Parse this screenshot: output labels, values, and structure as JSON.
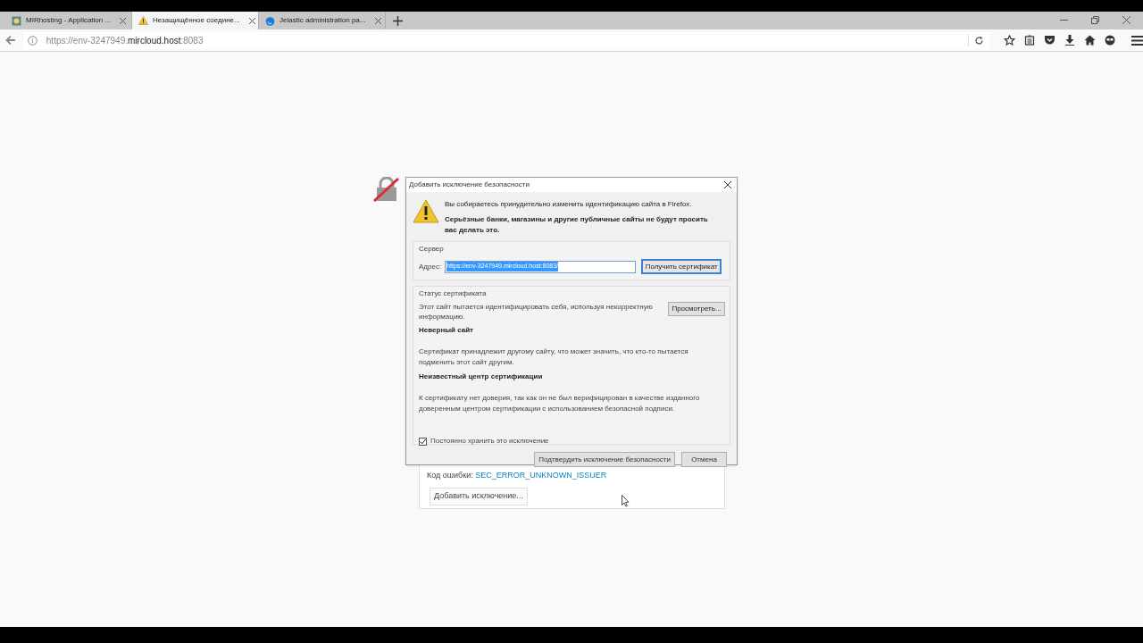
{
  "tabs": [
    {
      "title": "MIRhosting - Application ...",
      "selected": false
    },
    {
      "title": "Незащищённое соедине...",
      "selected": true
    },
    {
      "title": "Jelastic administration pa...",
      "selected": false
    }
  ],
  "url": {
    "prefix": "https://env-3247949.",
    "domain": "mircloud.host",
    "port": ":8083"
  },
  "dialog": {
    "title": "Добавить исключение безопасности",
    "warning_text": "Вы собираетесь принудительно изменить идентификацию сайта в Firefox.",
    "warning_bold": "Серьёзные банки, магазины и другие публичные сайты не будут просить вас делать это.",
    "server": {
      "legend": "Сервер",
      "address_label": "Адрес:",
      "address_value": "https://env-3247949.mircloud.host:8083/",
      "get_button": "Получить сертификат"
    },
    "status": {
      "legend": "Статус сертификата",
      "description": "Этот сайт пытается идентифицировать себя, используя некорректную информацию.",
      "view_button": "Просмотреть...",
      "problems": [
        {
          "title": "Неверный сайт",
          "text": "Сертификат принадлежит другому сайту, что может значить, что кто-то пытается подменить этот сайт другим."
        },
        {
          "title": "Неизвестный центр сертификации",
          "text": "К сертификату нет доверия, так как он не был верифицирован в качестве изданного доверенным центром сертификации с использованием безопасной подписи."
        }
      ]
    },
    "permanent": {
      "label": "Постоянно хранить это исключение",
      "checked": true
    },
    "buttons": [
      "Подтвердить исключение безопасности",
      "Отмена"
    ]
  },
  "error_card": {
    "code_label": "Код ошибки:",
    "code": "SEC_ERROR_UNKNOWN_ISSUER",
    "add_button": "Добавить исключение..."
  }
}
